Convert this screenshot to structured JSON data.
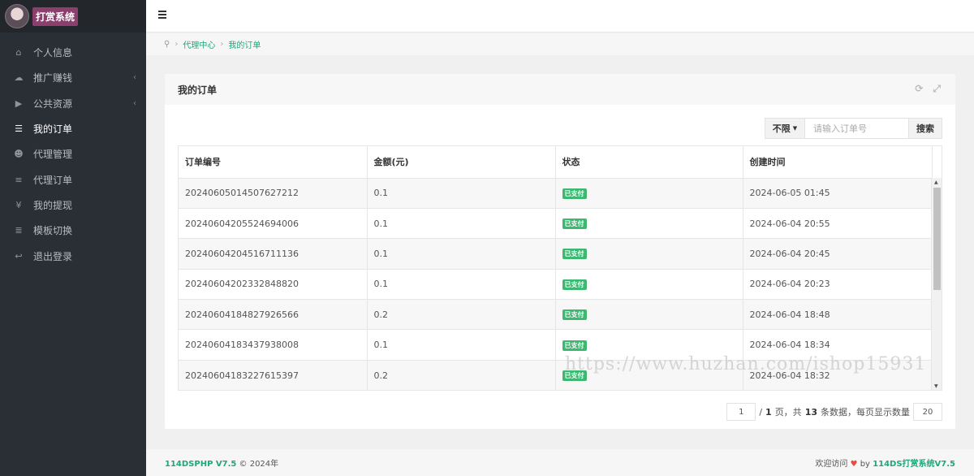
{
  "sidebar": {
    "brand_title": "打赏系统",
    "items": [
      {
        "label": "个人信息",
        "icon": "home-icon",
        "glyph": "⌂",
        "active": false,
        "arrow": ""
      },
      {
        "label": "推广赚钱",
        "icon": "cloud-icon",
        "glyph": "☁",
        "active": false,
        "arrow": "‹"
      },
      {
        "label": "公共资源",
        "icon": "video-icon",
        "glyph": "▶",
        "active": false,
        "arrow": "‹"
      },
      {
        "label": "我的订单",
        "icon": "list-icon",
        "glyph": "☰",
        "active": true,
        "arrow": ""
      },
      {
        "label": "代理管理",
        "icon": "users-icon",
        "glyph": "☻",
        "active": false,
        "arrow": ""
      },
      {
        "label": "代理订单",
        "icon": "bars-icon",
        "glyph": "≡",
        "active": false,
        "arrow": ""
      },
      {
        "label": "我的提现",
        "icon": "yen-icon",
        "glyph": "¥",
        "active": false,
        "arrow": ""
      },
      {
        "label": "模板切换",
        "icon": "list-alt-icon",
        "glyph": "≣",
        "active": false,
        "arrow": ""
      },
      {
        "label": "退出登录",
        "icon": "reply-icon",
        "glyph": "↩",
        "active": false,
        "arrow": ""
      }
    ]
  },
  "breadcrumb": {
    "home_icon": "map-marker-icon",
    "items": [
      "代理中心",
      "我的订单"
    ]
  },
  "panel": {
    "title": "我的订单",
    "filter_label": "不限",
    "search_placeholder": "请输入订单号",
    "search_button": "搜索"
  },
  "table": {
    "headers": [
      "订单编号",
      "金额(元)",
      "状态",
      "创建时间"
    ],
    "rows": [
      {
        "id": "20240605014507627212",
        "amount": "0.1",
        "status": "已支付",
        "time": "2024-06-05 01:45"
      },
      {
        "id": "20240604205524694006",
        "amount": "0.1",
        "status": "已支付",
        "time": "2024-06-04 20:55"
      },
      {
        "id": "20240604204516711136",
        "amount": "0.1",
        "status": "已支付",
        "time": "2024-06-04 20:45"
      },
      {
        "id": "20240604202332848820",
        "amount": "0.1",
        "status": "已支付",
        "time": "2024-06-04 20:23"
      },
      {
        "id": "20240604184827926566",
        "amount": "0.2",
        "status": "已支付",
        "time": "2024-06-04 18:48"
      },
      {
        "id": "20240604183437938008",
        "amount": "0.1",
        "status": "已支付",
        "time": "2024-06-04 18:34"
      },
      {
        "id": "20240604183227615397",
        "amount": "0.2",
        "status": "已支付",
        "time": "2024-06-04 18:32"
      }
    ]
  },
  "pager": {
    "current_page": "1",
    "total_pages": "1",
    "total_records": "13",
    "page_size": "20",
    "text_sep": "/",
    "text_page": "页，共",
    "text_records": "条数据，每页显示数量"
  },
  "watermark": "https://www.huzhan.com/ishop15931",
  "footer": {
    "left_brand": "114DSPHP V7.5",
    "left_suffix": "© 2024年",
    "right_prefix": "欢迎访问",
    "right_by": "by",
    "right_brand": "114DS打赏系统V7.5"
  },
  "colors": {
    "accent": "#1fa67a",
    "sidebar_bg": "#2a2f35",
    "badge_green": "#3cb871",
    "brand_badge": "#8a3f6c"
  }
}
